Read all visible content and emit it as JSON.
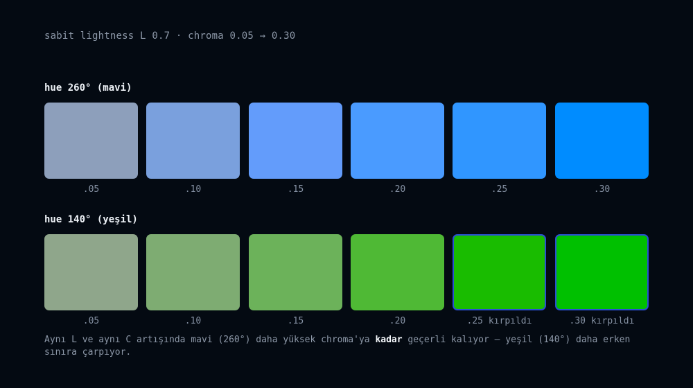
{
  "subtitle": "sabit lightness L 0.7 · chroma 0.05 → 0.30",
  "groups": [
    {
      "label": "hue 260° (mavi)",
      "swatches": [
        {
          "caption": ".05",
          "color": "#8d9fbb",
          "clipped": false
        },
        {
          "caption": ".10",
          "color": "#7aa0dd",
          "clipped": false
        },
        {
          "caption": ".15",
          "color": "#639cfb",
          "clipped": false
        },
        {
          "caption": ".20",
          "color": "#4a9bff",
          "clipped": false
        },
        {
          "caption": ".25",
          "color": "#3096ff",
          "clipped": false
        },
        {
          "caption": ".30",
          "color": "#008cff",
          "clipped": false
        }
      ]
    },
    {
      "label": "hue 140° (yeşil)",
      "swatches": [
        {
          "caption": ".05",
          "color": "#8fa68b",
          "clipped": false
        },
        {
          "caption": ".10",
          "color": "#7eac72",
          "clipped": false
        },
        {
          "caption": ".15",
          "color": "#6cb25a",
          "clipped": false
        },
        {
          "caption": ".20",
          "color": "#4fb935",
          "clipped": false
        },
        {
          "caption": ".25 kırpıldı",
          "color": "#19bc00",
          "clipped": true
        },
        {
          "caption": ".30 kırpıldı",
          "color": "#00c000",
          "clipped": true
        }
      ]
    }
  ],
  "note": {
    "before": "Aynı L ve aynı C artışında mavi (260°) daha yüksek chroma'ya ",
    "bold": "kadar",
    "after": " geçerli kalıyor — yeşil (140°) daha erken sınıra çarpıyor."
  },
  "clip_border_color": "#2a4fd4"
}
